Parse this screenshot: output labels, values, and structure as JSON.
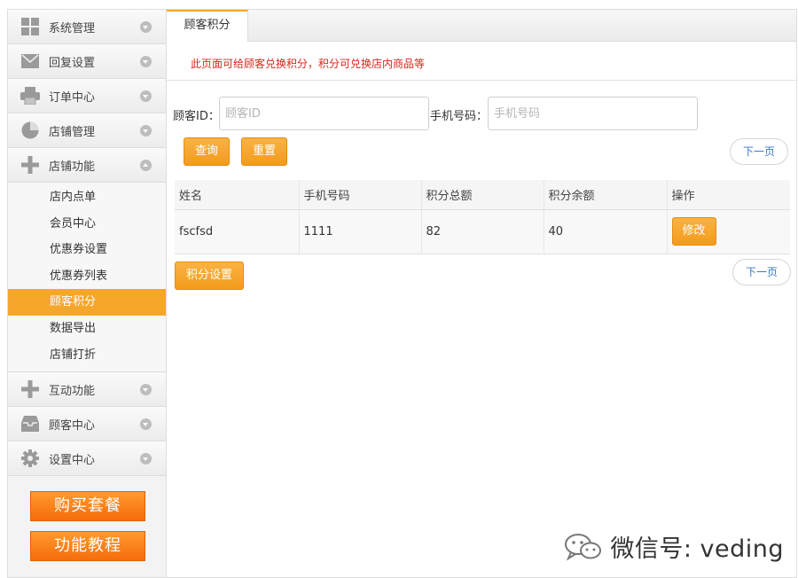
{
  "sidebar": {
    "menu": [
      {
        "label": "系统管理",
        "icon": "grid-icon"
      },
      {
        "label": "回复设置",
        "icon": "envelope-icon"
      },
      {
        "label": "订单中心",
        "icon": "printer-icon"
      },
      {
        "label": "店铺管理",
        "icon": "pie-chart-icon"
      },
      {
        "label": "店铺功能",
        "icon": "plus-icon"
      }
    ],
    "submenu": [
      "店内点单",
      "会员中心",
      "优惠券设置",
      "优惠券列表",
      "顾客积分",
      "数据导出",
      "店铺打折"
    ],
    "active_submenu": "顾客积分",
    "menu_after": [
      {
        "label": "互动功能",
        "icon": "plus-icon"
      },
      {
        "label": "顾客中心",
        "icon": "inbox-icon"
      },
      {
        "label": "设置中心",
        "icon": "gear-icon"
      }
    ],
    "buy_button": "购买套餐",
    "tutorial_button": "功能教程"
  },
  "main": {
    "tab": "顾客积分",
    "notice": "此页面可给顾客兑换积分，积分可兑换店内商品等",
    "search": {
      "customer_id_label": "顾客ID：",
      "customer_id_placeholder": "顾客ID",
      "phone_label": "手机号码：",
      "phone_placeholder": "手机号码",
      "query_button": "查询",
      "reset_button": "重置",
      "next_page": "下一页"
    },
    "table": {
      "headers": [
        "姓名",
        "手机号码",
        "积分总额",
        "积分余额",
        "操作"
      ],
      "rows": [
        {
          "name": "fscfsd",
          "phone": "1111",
          "total": "82",
          "balance": "40",
          "action": "修改"
        }
      ]
    },
    "points_settings_button": "积分设置",
    "next_page_bottom": "下一页"
  },
  "watermark": {
    "text": "微信号: veding",
    "icon": "wechat-icon"
  },
  "colors": {
    "accent": "#f5a72c",
    "notice": "#d9261c",
    "cta": "#f56d0b",
    "link": "#3a7bc8"
  }
}
